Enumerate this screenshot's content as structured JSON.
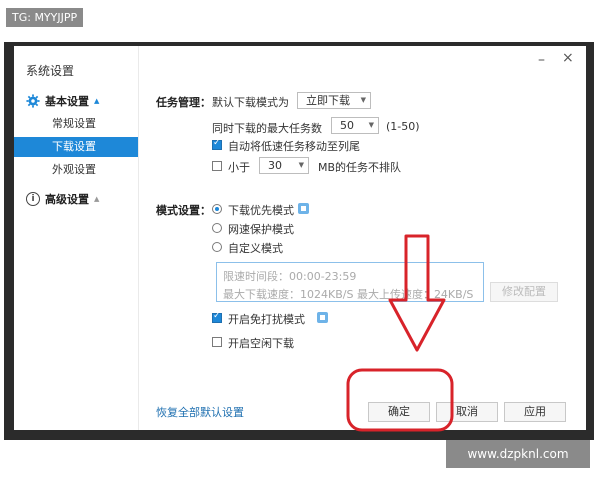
{
  "watermarks": {
    "top_left": "TG: MYYJJPP",
    "bottom_right": "www.dzpknl.com"
  },
  "titlebar": {
    "minimize": "–",
    "close": "×"
  },
  "sidebar": {
    "title": "系统设置",
    "group_basic": "基本设置",
    "items": [
      "常规设置",
      "下载设置",
      "外观设置"
    ],
    "active_index": 1,
    "group_advanced": "高级设置"
  },
  "task_mgmt": {
    "label": "任务管理：",
    "default_mode_label": "默认下载模式为",
    "default_mode_value": "立即下载",
    "max_tasks_label": "同时下载的最大任务数",
    "max_tasks_value": "50",
    "max_tasks_range": "(1-50)",
    "auto_move_label": "自动将低速任务移动至列尾",
    "auto_move_checked": true,
    "less_than_label": "小于",
    "less_than_value": "30",
    "less_than_suffix": "MB的任务不排队",
    "less_than_checked": false
  },
  "mode": {
    "label": "模式设置：",
    "options": [
      "下载优先模式",
      "网速保护模式",
      "自定义模式"
    ],
    "selected_index": 0,
    "time_text": "限速时间段：00:00-23:59",
    "speed_text": "最大下载速度：1024KB/S  最大上传速度：24KB/S",
    "modify_button": "修改配置",
    "no_disturb_label": "开启免打扰模式",
    "no_disturb_checked": true,
    "idle_label": "开启空闲下载",
    "idle_checked": false
  },
  "footer": {
    "restore_link": "恢复全部默认设置",
    "ok": "确定",
    "cancel": "取消",
    "apply": "应用"
  },
  "annotation_color": "#d8232a",
  "accent_color": "#1e88d8"
}
